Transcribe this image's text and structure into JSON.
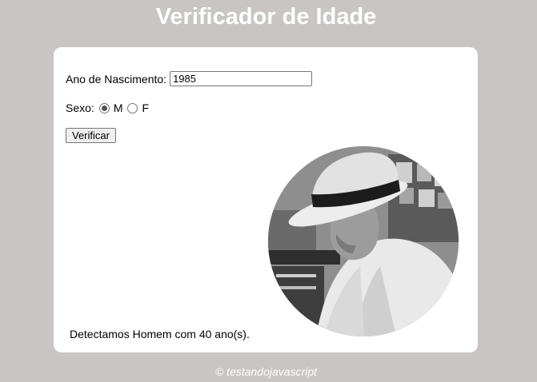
{
  "header": {
    "title": "Verificador de Idade"
  },
  "form": {
    "year_label": "Ano de Nascimento:",
    "year_value": "1985",
    "sex_label": "Sexo:",
    "options": [
      {
        "label": "M",
        "checked": true
      },
      {
        "label": "F",
        "checked": false
      }
    ],
    "verify_label": "Verificar"
  },
  "result": {
    "text": "Detectamos Homem com 40 ano(s)."
  },
  "footer": {
    "text": "© testandojavascript"
  },
  "photo": {
    "subject": "man-with-hat-photo"
  }
}
